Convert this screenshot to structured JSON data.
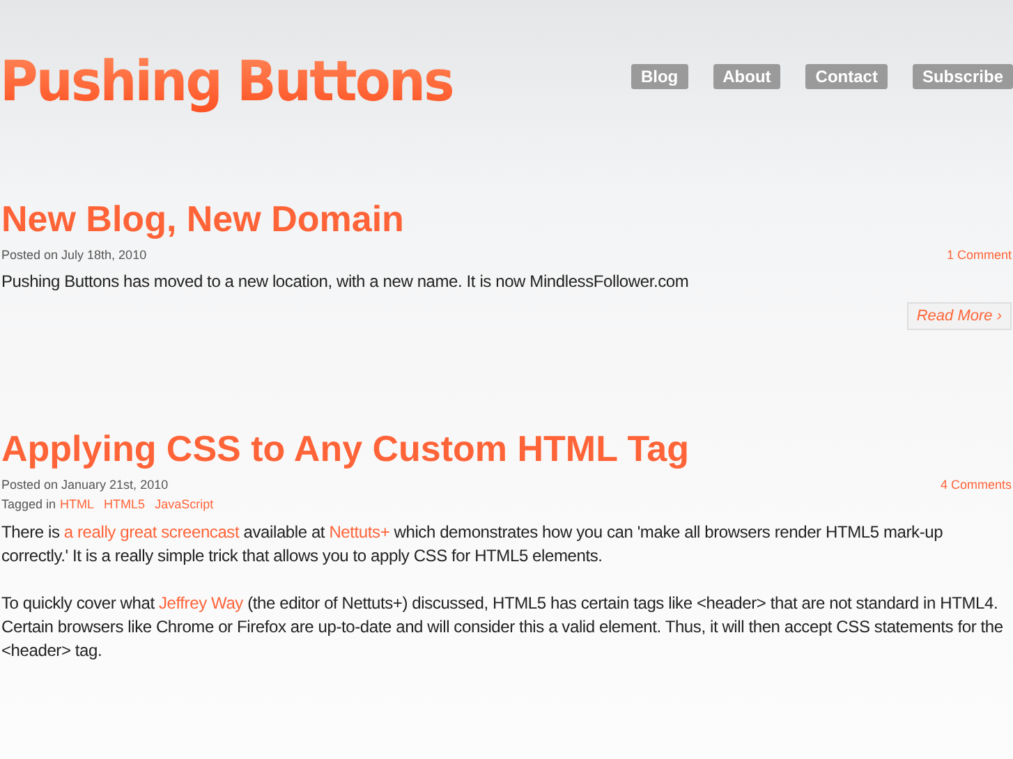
{
  "site": {
    "logo": "Pushing Buttons",
    "nav": [
      "Blog",
      "About",
      "Contact",
      "Subscribe"
    ]
  },
  "posts": [
    {
      "title": "New Blog, New Domain",
      "posted": "Posted on July 18th, 2010",
      "comments": "1 Comment",
      "paragraphs": [
        [
          {
            "kind": "text",
            "text": "Pushing Buttons has moved to a new location, with a new name. It is now MindlessFollower.com"
          }
        ]
      ],
      "read_more": "Read More ›"
    },
    {
      "title": "Applying CSS to Any Custom HTML Tag",
      "posted": "Posted on January 21st, 2010",
      "comments": "4 Comments",
      "tags_label": "Tagged in",
      "tags": [
        "HTML",
        "HTML5",
        "JavaScript"
      ],
      "paragraphs": [
        [
          {
            "kind": "text",
            "text": "There is "
          },
          {
            "kind": "link",
            "text": "a really great screencast"
          },
          {
            "kind": "text",
            "text": " available at "
          },
          {
            "kind": "link",
            "text": "Nettuts+"
          },
          {
            "kind": "text",
            "text": " which demonstrates how you can 'make all browsers render HTML5 mark-up correctly.' It is a really simple trick that allows you to apply CSS for HTML5 elements."
          }
        ],
        [
          {
            "kind": "text",
            "text": "To quickly cover what "
          },
          {
            "kind": "link",
            "text": "Jeffrey Way"
          },
          {
            "kind": "text",
            "text": " (the editor of Nettuts+) discussed, HTML5 has certain tags like <header> that are not standard in HTML4. Certain browsers like Chrome or Firefox are up-to-date and will consider this a valid element. Thus, it will then accept CSS statements for the <header> tag."
          }
        ]
      ]
    }
  ]
}
